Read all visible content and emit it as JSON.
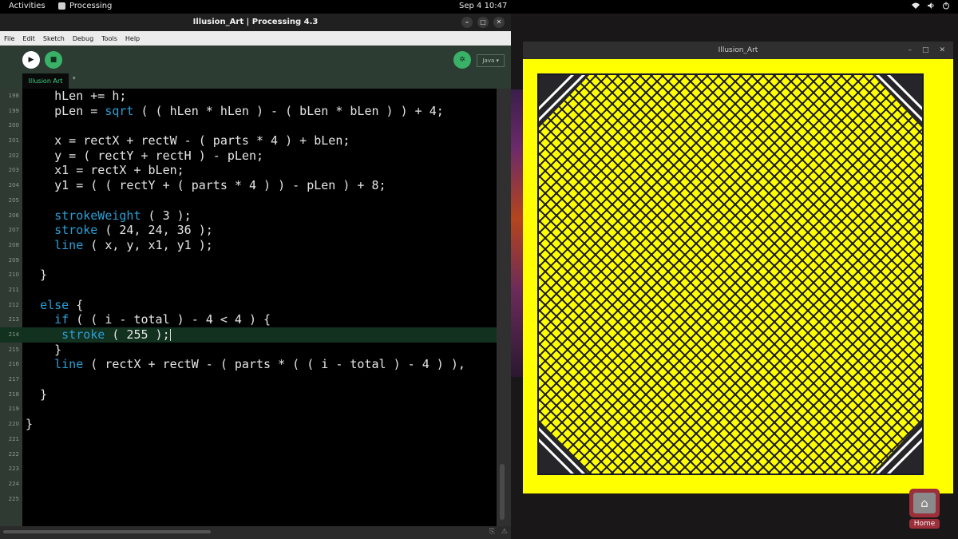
{
  "topbar": {
    "activities": "Activities",
    "app_name": "Processing",
    "clock": "Sep 4  10:47",
    "wifi_icon": "wifi-icon",
    "volume_icon": "volume-icon",
    "power_icon": "power-icon"
  },
  "ide": {
    "title": "Illusion_Art | Processing 4.3",
    "menu": [
      "File",
      "Edit",
      "Sketch",
      "Debug",
      "Tools",
      "Help"
    ],
    "mode": "Java ▾",
    "tab": "Illusion Art",
    "lines": [
      {
        "num": "198",
        "text": "    hLen += h;"
      },
      {
        "num": "199",
        "pre": "    pLen = ",
        "kw": "sqrt",
        "post": " ( ( hLen * hLen ) - ( bLen * bLen ) ) + 4;"
      },
      {
        "num": "200",
        "text": ""
      },
      {
        "num": "201",
        "text": "    x = rectX + rectW - ( parts * 4 ) + bLen;"
      },
      {
        "num": "202",
        "text": "    y = ( rectY + rectH ) - pLen;"
      },
      {
        "num": "203",
        "text": "    x1 = rectX + bLen;"
      },
      {
        "num": "204",
        "text": "    y1 = ( ( rectY + ( parts * 4 ) ) - pLen ) + 8;"
      },
      {
        "num": "205",
        "text": ""
      },
      {
        "num": "206",
        "pre": "    ",
        "kw": "strokeWeight",
        "post": " ( 3 );"
      },
      {
        "num": "207",
        "pre": "    ",
        "kw": "stroke",
        "post": " ( 24, 24, 36 );"
      },
      {
        "num": "208",
        "pre": "    ",
        "kw": "line",
        "post": " ( x, y, x1, y1 );"
      },
      {
        "num": "209",
        "text": ""
      },
      {
        "num": "210",
        "text": "  }"
      },
      {
        "num": "211",
        "text": ""
      },
      {
        "num": "212",
        "pre": "  ",
        "kw": "else",
        "post": " {"
      },
      {
        "num": "213",
        "pre": "    ",
        "kw": "if",
        "post": " ( ( i - total ) - 4 < 4 ) {"
      },
      {
        "num": "214",
        "pre": "     ",
        "kw": "stroke",
        "post": " ( 255 );",
        "current": true
      },
      {
        "num": "215",
        "text": "    }"
      },
      {
        "num": "216",
        "pre": "    ",
        "kw": "line",
        "post": " ( rectX + rectW - ( parts * ( ( i - total ) - 4 ) ),"
      },
      {
        "num": "217",
        "text": ""
      },
      {
        "num": "218",
        "text": "  }"
      },
      {
        "num": "219",
        "text": ""
      },
      {
        "num": "220",
        "text": "}"
      },
      {
        "num": "221",
        "text": ""
      },
      {
        "num": "222",
        "text": ""
      },
      {
        "num": "223",
        "text": ""
      },
      {
        "num": "224",
        "text": ""
      },
      {
        "num": "225",
        "text": ""
      }
    ]
  },
  "sketch": {
    "title": "Illusion_Art",
    "colors": {
      "background": "#ffff00",
      "panel": "#ffff00",
      "lines": "#18182a",
      "corner": "#26262a",
      "corner_stripes": "#ffffff"
    }
  },
  "dock": {
    "home_label": "Home"
  }
}
